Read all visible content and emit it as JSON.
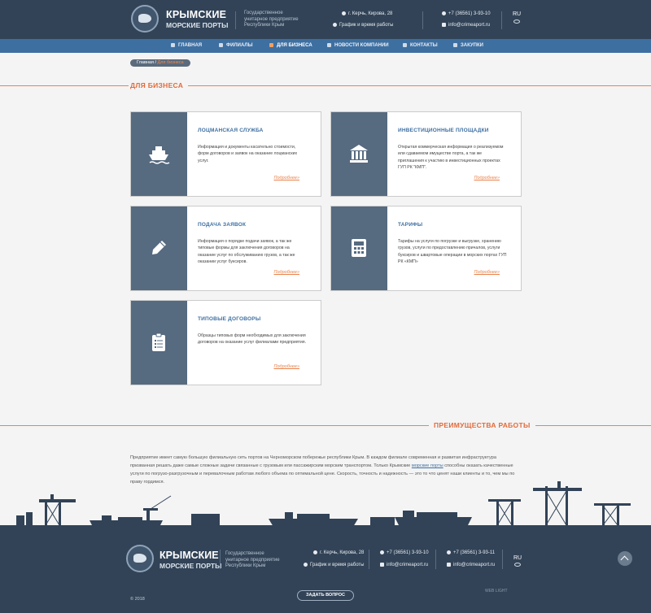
{
  "header": {
    "logo_title": "КРЫМСКИЕ",
    "logo_subtitle": "МОРСКИЕ ПОРТЫ",
    "org_name": "Государственное унитарное предприятие Республики Крым",
    "address": "г. Керчь, Кирова, 28",
    "schedule": "График и время работы",
    "phone": "+7 (36561) 3-93-10",
    "email": "info@crimeaport.ru",
    "language": "RU"
  },
  "nav": {
    "items": [
      {
        "label": "ГЛАВНАЯ",
        "icon": "home-icon"
      },
      {
        "label": "ФИЛИАЛЫ",
        "icon": "branches-icon"
      },
      {
        "label": "ДЛЯ БИЗНЕСА",
        "icon": "business-icon",
        "active": true
      },
      {
        "label": "НОВОСТИ КОМПАНИИ",
        "icon": "news-icon"
      },
      {
        "label": "КОНТАКТЫ",
        "icon": "contacts-icon"
      },
      {
        "label": "ЗАКУПКИ",
        "icon": "purchases-icon"
      }
    ]
  },
  "breadcrumb": {
    "home": "Главная",
    "separator": "/",
    "current": "Для бизнеса"
  },
  "page": {
    "title": "ДЛЯ БИЗНЕСА"
  },
  "cards": [
    {
      "title": "ЛОЦМАНСКАЯ СЛУЖБА",
      "text": "Информация и документы касательно стоимости, форм договоров и заявок на оказание лоцманских услуг.",
      "more": "Подробнее»",
      "icon": "ship-icon"
    },
    {
      "title": "ИНВЕСТИЦИОННЫЕ ПЛОЩАДКИ",
      "text": "Открытая коммерческая информация о реализуемом или сдаваемом имуществе порта, а так же приглашения к участию в инвестиционных проектах ГУП РК \"КМП\".",
      "more": "Подробнее»",
      "icon": "bank-icon"
    },
    {
      "title": "ПОДАЧА ЗАЯВОК",
      "text": "Информация о порядке подачи заявок, а так же типовые формы для заключения договоров на оказание услуг по обслуживанию грузов, а так же оказании услуг буксиров.",
      "more": "Подробнее»",
      "icon": "pencil-icon"
    },
    {
      "title": "ТАРИФЫ",
      "text": "Тарифы на услуги по погрузке и выгрузке, хранению грузов, услуги по предоставлению причалов, услуги буксиров и швартовые операции в морских портах ГУП РК «КМП»",
      "more": "Подробнее»",
      "icon": "calculator-icon"
    },
    {
      "title": "ТИПОВЫЕ ДОГОВОРЫ",
      "text": "Образцы типовых форм необходимых для заключения договоров на оказание услуг филиалами предприятия.",
      "more": "Подробнее»",
      "icon": "clipboard-icon"
    }
  ],
  "advantages": {
    "title": "ПРЕИМУЩЕСТВА РАБОТЫ",
    "text_before": "Предприятие имеет самую большую филиальную сеть портов на Черноморском побережье республики Крым. В каждом филиале современная и развитая инфраструктура призванная решать даже самые сложные задачи связанные с грузовым или пассажирским морским транспортом. Только Крымские ",
    "link": "морские порты",
    "text_after": " способны оказать качественные услуги по погрузо-разгрузочным и перевалочным работам любого объема по оптимальной цене. Скорость, точность и надежность — это то что ценят наши клиенты и то, чем мы по праву гордимся."
  },
  "footer": {
    "logo_title": "КРЫМСКИЕ",
    "logo_subtitle": "МОРСКИЕ ПОРТЫ",
    "org_name": "Государственное унитарное предприятие Республики Крым",
    "address": "г. Керчь, Кирова, 28",
    "schedule": "График и время работы",
    "phone1": "+7 (36561) 3-93-10",
    "email1": "info@crimeaport.ru",
    "phone2": "+7 (36561) 3-93-11",
    "email2": "info@crimeaport.ru",
    "language": "RU",
    "copyright": "©  2018",
    "ask_button": "ЗАДАТЬ ВОПРОС",
    "developer": "WEB LIGHT"
  },
  "colors": {
    "header_bg": "#324357",
    "nav_bg": "#3e6fa1",
    "accent": "#e26a3a",
    "card_side": "#566a80"
  }
}
